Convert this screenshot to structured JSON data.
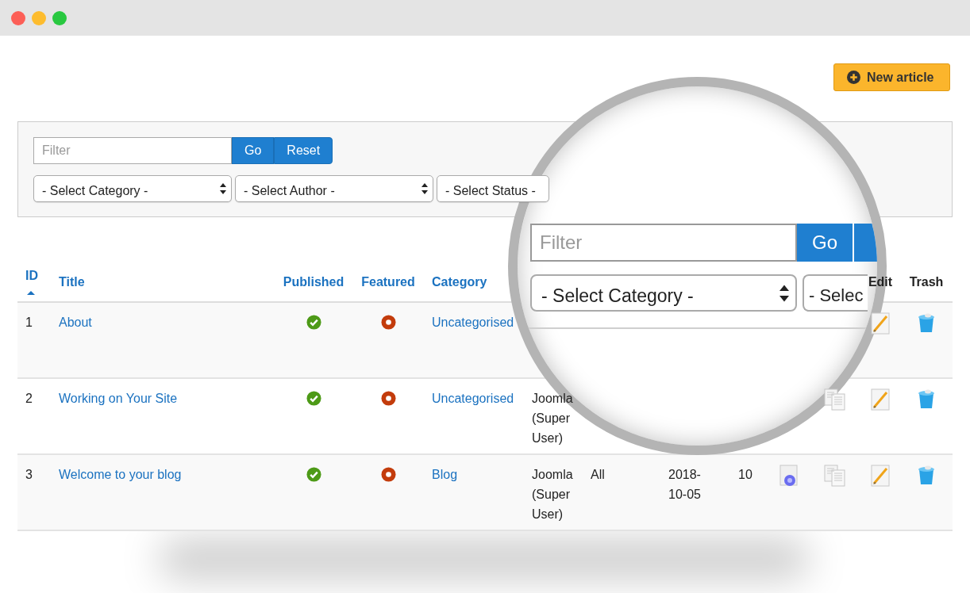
{
  "toolbar": {
    "new_button": "New article"
  },
  "filters": {
    "search_placeholder": "Filter",
    "buttons": [
      "Go",
      "Reset"
    ],
    "selects": [
      "- Select Category -",
      "- Select Author -",
      "- Select Status -"
    ]
  },
  "table": {
    "columns": [
      {
        "label": "ID",
        "sorted": true
      },
      {
        "label": "Title"
      },
      {
        "label": "Published"
      },
      {
        "label": "Featured"
      },
      {
        "label": "Category"
      },
      {},
      {},
      {},
      {},
      {},
      {},
      {
        "label": "Edit"
      },
      {
        "label": "Trash"
      }
    ],
    "rows": [
      {
        "id": "1",
        "title": "About",
        "published": true,
        "featured": false,
        "category": "Uncategorised",
        "edit": true,
        "trash": true
      },
      {
        "id": "2",
        "title": "Working on Your Site",
        "published": true,
        "featured": false,
        "category": "Uncategorised",
        "author": "Joomla (Super User)",
        "versions": true,
        "edit": true,
        "trash": true
      },
      {
        "id": "3",
        "title": "Welcome to your blog",
        "published": true,
        "featured": false,
        "category": "Blog",
        "author": "Joomla (Super User)",
        "access": "All",
        "created": "2018-10-05",
        "hits": "10",
        "associations": true,
        "versions": true,
        "edit": true,
        "trash": true
      }
    ]
  },
  "magnifier": {
    "search_placeholder": "Filter",
    "go_button": "Go",
    "selects": [
      "- Select Category -",
      "- Selec"
    ]
  }
}
